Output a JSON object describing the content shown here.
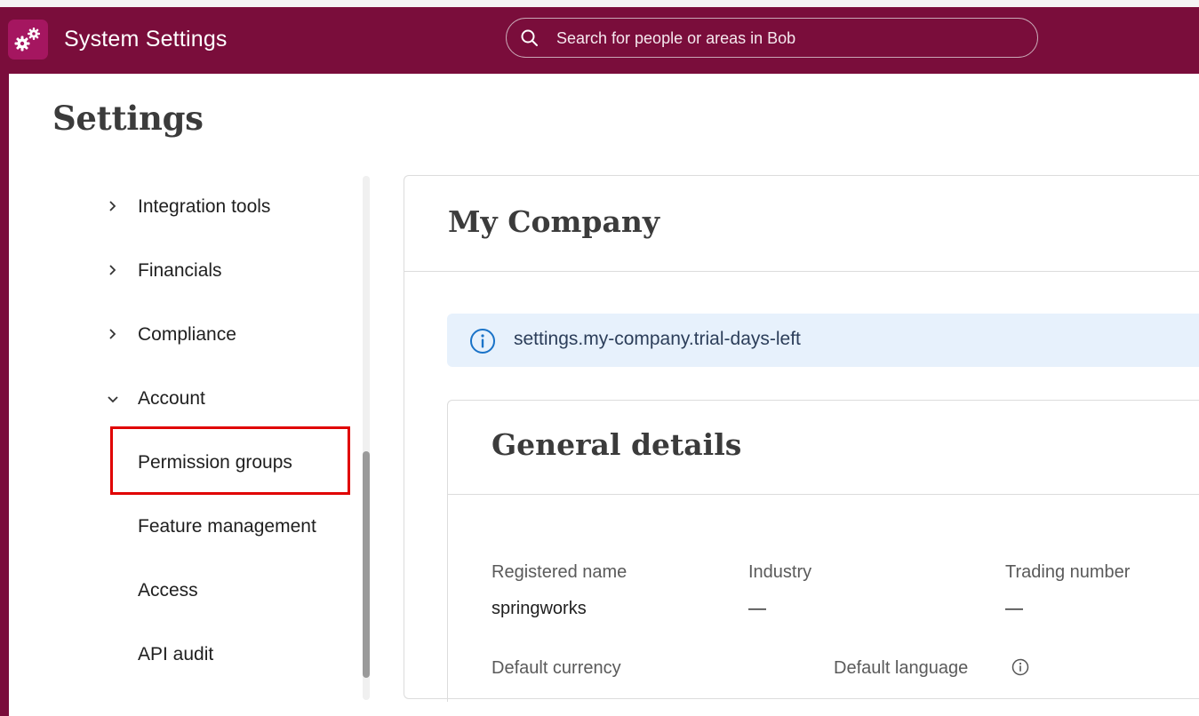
{
  "header": {
    "app_title": "System Settings",
    "logo_icon": "gears-icon",
    "search_placeholder": "Search for people or areas in Bob",
    "brand_color": "#7a0d3b"
  },
  "page": {
    "title": "Settings"
  },
  "sidebar": {
    "items": [
      {
        "label": "Integration tools",
        "state": "collapsed"
      },
      {
        "label": "Financials",
        "state": "collapsed"
      },
      {
        "label": "Compliance",
        "state": "collapsed"
      },
      {
        "label": "Account",
        "state": "expanded"
      }
    ],
    "sub_items": [
      {
        "label": "Permission groups",
        "highlighted": true
      },
      {
        "label": "Feature management"
      },
      {
        "label": "Access"
      },
      {
        "label": "API audit"
      }
    ]
  },
  "main": {
    "title": "My Company",
    "banner_text": "settings.my-company.trial-days-left",
    "section_title": "General details",
    "fields": [
      {
        "label": "Registered name",
        "value": "springworks"
      },
      {
        "label": "Industry",
        "value": "—"
      },
      {
        "label": "Trading number",
        "value": "—"
      },
      {
        "label": "Default currency",
        "value": ""
      },
      {
        "label": "Default language",
        "value": ""
      }
    ]
  },
  "colors": {
    "highlight": "#e00000",
    "banner_bg": "#e7f1fc",
    "info_icon": "#1a73c8"
  }
}
